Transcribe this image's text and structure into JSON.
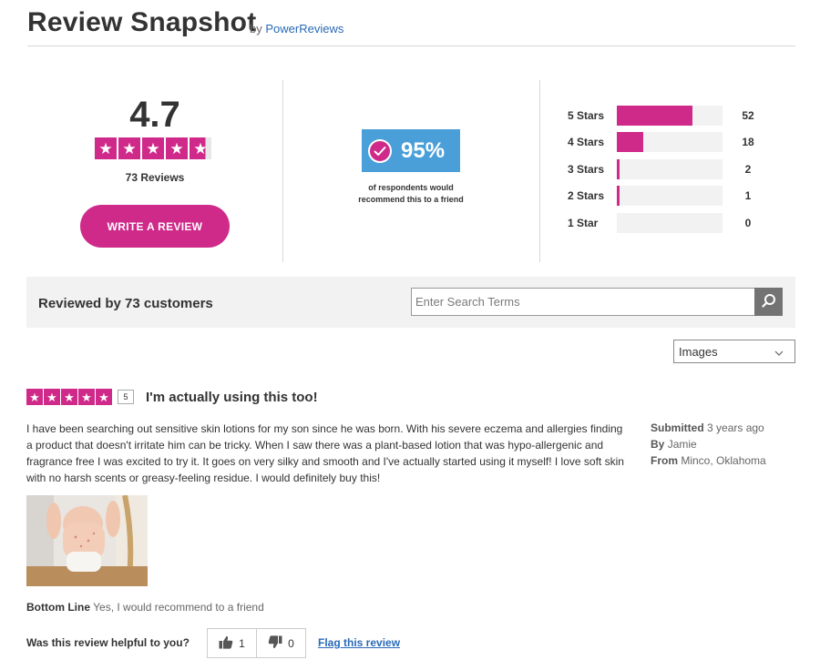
{
  "header": {
    "title": "Review Snapshot",
    "by_prefix": "by",
    "by_link": "PowerReviews"
  },
  "snapshot": {
    "average": "4.7",
    "average_value": 4.7,
    "stars_max": 5,
    "review_count_label": "73 Reviews",
    "write_button": "WRITE A REVIEW"
  },
  "recommend": {
    "percent": "95%",
    "text": "of respondents would recommend this to a friend"
  },
  "histogram": [
    {
      "label": "5 Stars",
      "count": "52",
      "value": 52
    },
    {
      "label": "4 Stars",
      "count": "18",
      "value": 18
    },
    {
      "label": "3 Stars",
      "count": "2",
      "value": 2
    },
    {
      "label": "2 Stars",
      "count": "1",
      "value": 1
    },
    {
      "label": "1 Star",
      "count": "0",
      "value": 0
    }
  ],
  "reviews_bar": {
    "heading": "Reviewed by 73 customers",
    "search_placeholder": "Enter Search Terms"
  },
  "sort_select": {
    "value": "Images"
  },
  "review": {
    "rating": "5",
    "headline": "I'm actually using this too!",
    "body": "I have been searching out sensitive skin lotions for my son since he was born. With his severe eczema and allergies finding a product that doesn't irritate him can be tricky. When I saw there was a plant-based lotion that was hypo-allergenic and fragrance free I was excited to try it. It goes on very silky and smooth and I've actually started using it myself! I love soft skin with no harsh scents or greasy-feeling residue. I would definitely buy this!",
    "submitted_label": "Submitted",
    "submitted_value": "3 years ago",
    "by_label": "By",
    "by_value": "Jamie",
    "from_label": "From",
    "from_value": "Minco, Oklahoma",
    "bottom_line_label": "Bottom Line",
    "bottom_line_value": "Yes, I would recommend to a friend",
    "helpful_question": "Was this review helpful to you?",
    "helpful_yes": "1",
    "helpful_no": "0",
    "flag_link": "Flag this review"
  },
  "colors": {
    "accent": "#cf2a8a",
    "recommend_bg": "#4a9fd9",
    "link": "#2a6ab8"
  },
  "icons": {
    "search": "search-icon",
    "thumbs_up": "thumbs-up-icon",
    "thumbs_down": "thumbs-down-icon",
    "check": "check-circle-icon",
    "chevron": "chevron-down-icon",
    "star": "star-icon"
  }
}
